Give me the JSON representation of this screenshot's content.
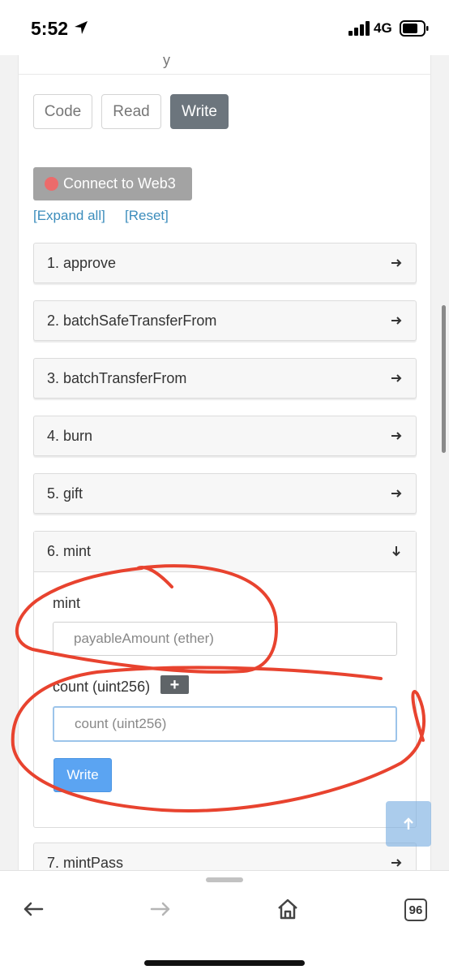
{
  "status_bar": {
    "time": "5:52",
    "network": "4G"
  },
  "page": {
    "partial_top_text": "y"
  },
  "tabs": [
    {
      "label": "Code",
      "active": false
    },
    {
      "label": "Read",
      "active": false
    },
    {
      "label": "Write",
      "active": true
    }
  ],
  "connect_button": "Connect to Web3",
  "links": {
    "expand_all": "[Expand all]",
    "reset": "[Reset]"
  },
  "functions": [
    {
      "label": "1. approve",
      "expanded": false
    },
    {
      "label": "2. batchSafeTransferFrom",
      "expanded": false
    },
    {
      "label": "3. batchTransferFrom",
      "expanded": false
    },
    {
      "label": "4. burn",
      "expanded": false
    },
    {
      "label": "5. gift",
      "expanded": false
    },
    {
      "label": "6. mint",
      "expanded": true
    },
    {
      "label": "7. mintPass",
      "expanded": false
    }
  ],
  "mint_form": {
    "payable_label": "mint",
    "payable_placeholder": "payableAmount (ether)",
    "count_label": "count (uint256)",
    "plus_label": "+",
    "count_placeholder": "count (uint256)",
    "write_label": "Write"
  },
  "browser_bar": {
    "tab_count": "96"
  },
  "colors": {
    "active_tab": "#6c757d",
    "link": "#3c8dbc",
    "write_button": "#5ba4f2",
    "annotation": "#e8432f",
    "connect_dot": "#ec6b6b"
  },
  "icons": [
    "location-arrow-icon",
    "signal-icon",
    "battery-icon",
    "arrow-right-icon",
    "arrow-down-icon",
    "arrow-up-icon",
    "back-icon",
    "forward-icon",
    "home-icon"
  ]
}
